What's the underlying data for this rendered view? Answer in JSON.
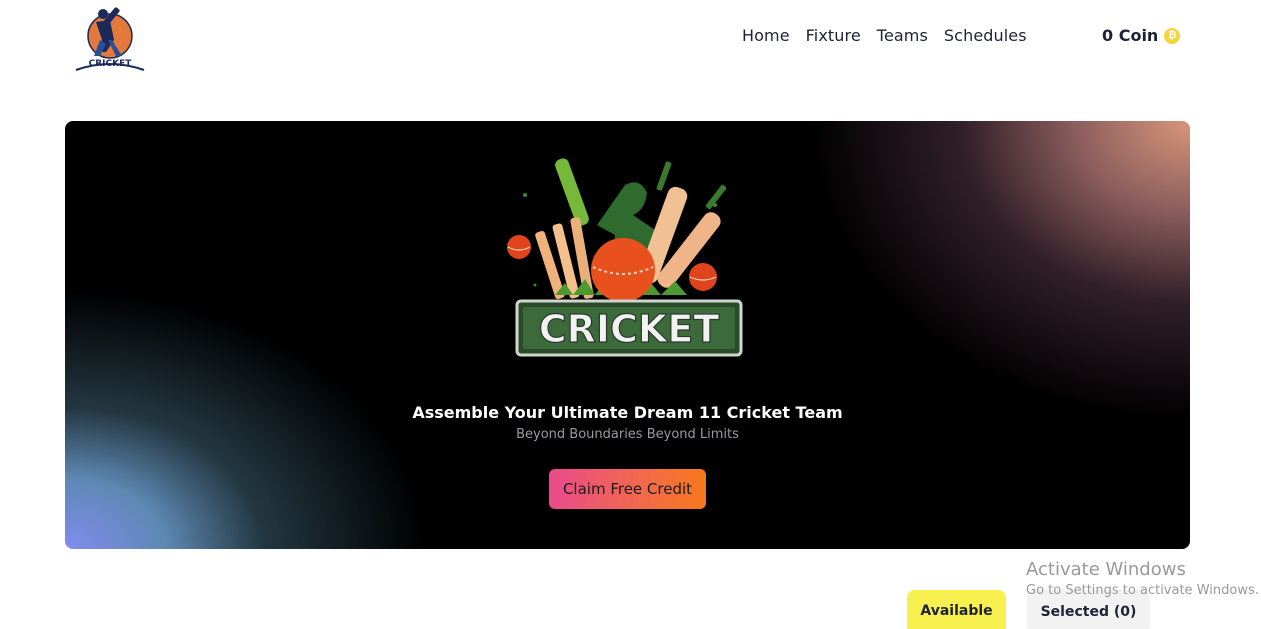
{
  "header": {
    "logo_text": "CRICKET",
    "nav": [
      "Home",
      "Fixture",
      "Teams",
      "Schedules"
    ],
    "coin_label": "0 Coin",
    "coin_icon": "coin-icon"
  },
  "hero": {
    "emblem_text": "CRICKET",
    "title": "Assemble Your Ultimate Dream 11 Cricket Team",
    "subtitle": "Beyond Boundaries Beyond Limits",
    "claim_button": "Claim Free Credit"
  },
  "toggle": {
    "available": "Available",
    "selected": "Selected (0)"
  },
  "watermark": {
    "title": "Activate Windows",
    "subtitle": "Go to Settings to activate Windows."
  },
  "colors": {
    "accent_yellow": "#f7f04f",
    "claim_gradient_start": "#ea4a8c",
    "claim_gradient_end": "#f7791c",
    "coin": "#f5d63a"
  }
}
